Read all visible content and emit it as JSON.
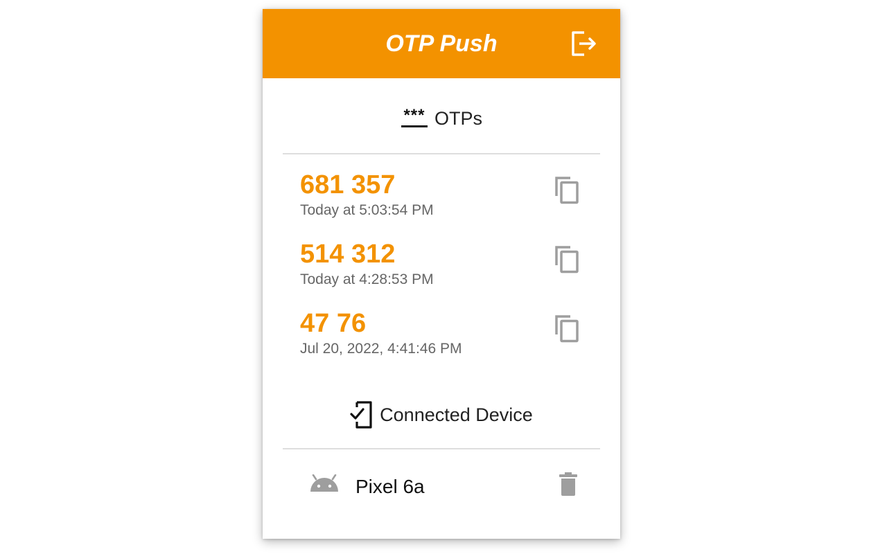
{
  "header": {
    "title": "OTP Push",
    "logout_icon": "logout-icon",
    "color": "#f39200"
  },
  "otps_section": {
    "title_prefix": "***",
    "title": "OTPs",
    "items": [
      {
        "code": "681 357",
        "time": "Today at 5:03:54 PM",
        "action_icon": "copy-icon"
      },
      {
        "code": "514 312",
        "time": "Today at 4:28:53 PM",
        "action_icon": "copy-icon"
      },
      {
        "code": "47 76",
        "time": "Jul 20, 2022, 4:41:46 PM",
        "action_icon": "copy-icon"
      }
    ]
  },
  "device_section": {
    "title": "Connected Device",
    "icon": "phone-check-icon",
    "device": {
      "name": "Pixel 6a",
      "platform_icon": "android-icon",
      "delete_icon": "trash-icon"
    }
  },
  "colors": {
    "accent": "#f39200",
    "timestamp": "#666666",
    "icon_gray": "#9e9e9e",
    "divider": "#dedede"
  }
}
